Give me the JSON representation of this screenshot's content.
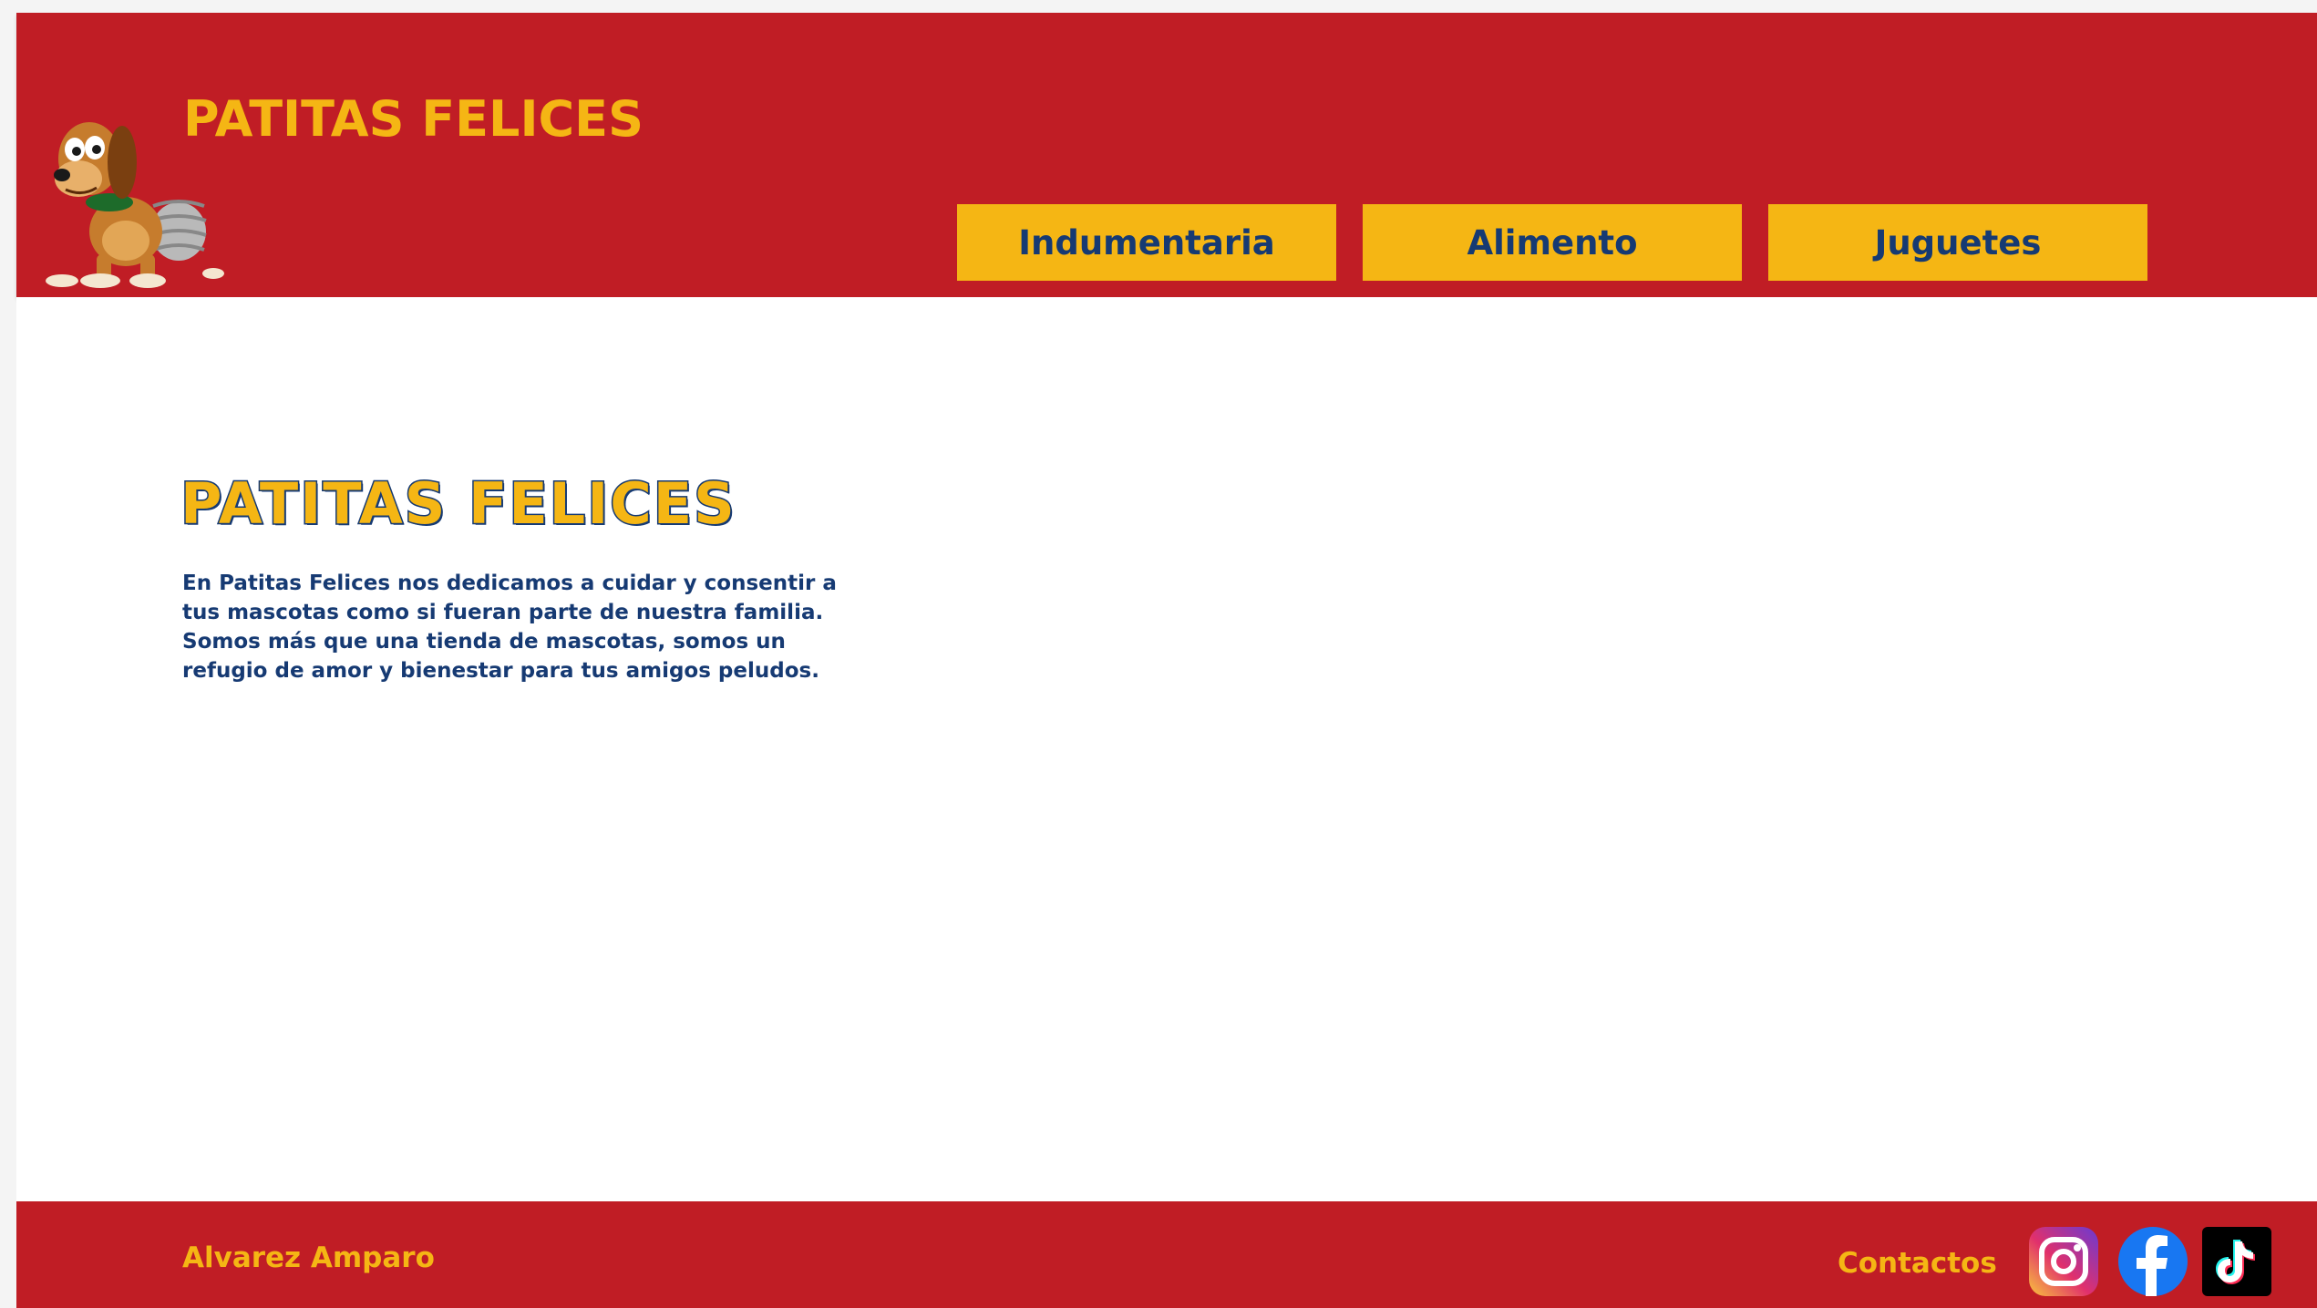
{
  "header": {
    "brand": "PATITAS FELICES",
    "logo_icon": "slinky-dog-logo"
  },
  "nav": {
    "items": [
      {
        "label": "Indumentaria"
      },
      {
        "label": "Alimento"
      },
      {
        "label": "Juguetes"
      }
    ]
  },
  "hero": {
    "title": "PATITAS FELICES",
    "text": "En Patitas Felices nos dedicamos a cuidar y consentir a tus mascotas como si fueran parte de nuestra familia. Somos más que una tienda de mascotas, somos un refugio de amor y bienestar para tus amigos peludos."
  },
  "footer": {
    "author": "Alvarez Amparo",
    "contact_label": "Contactos",
    "social": [
      {
        "icon": "instagram-icon"
      },
      {
        "icon": "facebook-icon"
      },
      {
        "icon": "tiktok-icon"
      }
    ]
  },
  "colors": {
    "primary_red": "#c01d25",
    "accent_yellow": "#f5b614",
    "navy_text": "#163a73",
    "background": "#ffffff"
  }
}
